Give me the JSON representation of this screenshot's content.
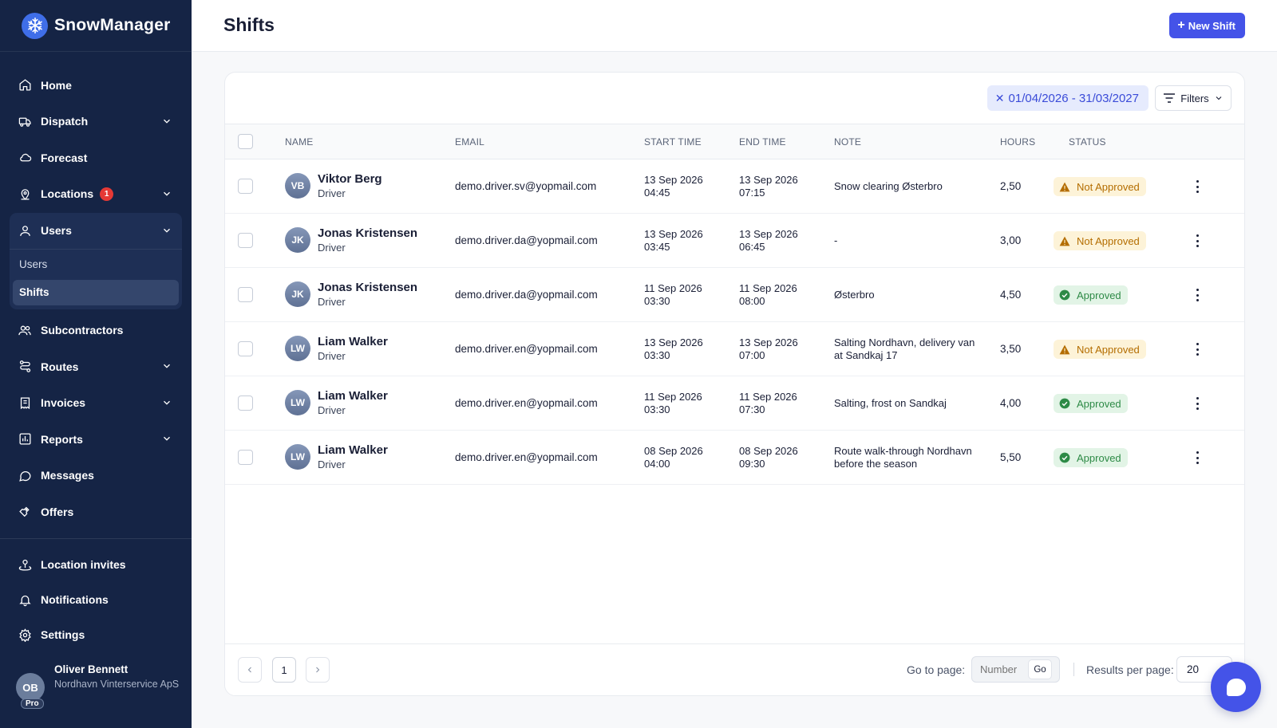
{
  "brand": {
    "name": "SnowManager"
  },
  "sidebar": {
    "items": [
      {
        "label": "Home",
        "icon": "home-icon"
      },
      {
        "label": "Dispatch",
        "icon": "truck-icon",
        "expandable": true
      },
      {
        "label": "Forecast",
        "icon": "cloud-icon"
      },
      {
        "label": "Locations",
        "icon": "pin-icon",
        "expandable": true,
        "badge": "1"
      },
      {
        "label": "Users",
        "icon": "user-icon",
        "expandable": true,
        "expanded": true,
        "children": [
          "Users",
          "Shifts"
        ],
        "active_child": "Shifts"
      },
      {
        "label": "Subcontractors",
        "icon": "users-icon"
      },
      {
        "label": "Routes",
        "icon": "route-icon",
        "expandable": true
      },
      {
        "label": "Invoices",
        "icon": "invoice-icon",
        "expandable": true
      },
      {
        "label": "Reports",
        "icon": "chart-icon",
        "expandable": true
      },
      {
        "label": "Messages",
        "icon": "message-icon"
      },
      {
        "label": "Offers",
        "icon": "offer-icon"
      }
    ],
    "bottom_items": [
      {
        "label": "Location invites",
        "icon": "location-invite-icon"
      },
      {
        "label": "Notifications",
        "icon": "bell-icon"
      },
      {
        "label": "Settings",
        "icon": "gear-icon"
      }
    ],
    "profile": {
      "initials": "OB",
      "plan": "Pro",
      "name": "Oliver Bennett",
      "org": "Nordhavn Vinterservice ApS"
    }
  },
  "header": {
    "title": "Shifts",
    "new_button": "New Shift"
  },
  "toolbar": {
    "date_range": "01/04/2026 - 31/03/2027",
    "filters_label": "Filters"
  },
  "table": {
    "columns": [
      "NAME",
      "EMAIL",
      "START TIME",
      "END TIME",
      "NOTE",
      "HOURS",
      "STATUS"
    ],
    "rows": [
      {
        "initials": "VB",
        "name": "Viktor Berg",
        "role": "Driver",
        "email": "demo.driver.sv@yopmail.com",
        "start_date": "13 Sep 2026",
        "start_time": "04:45",
        "end_date": "13 Sep 2026",
        "end_time": "07:15",
        "note": "Snow clearing Østerbro",
        "hours": "2,50",
        "status": "Not Approved",
        "status_kind": "warning"
      },
      {
        "initials": "JK",
        "name": "Jonas Kristensen",
        "role": "Driver",
        "email": "demo.driver.da@yopmail.com",
        "start_date": "13 Sep 2026",
        "start_time": "03:45",
        "end_date": "13 Sep 2026",
        "end_time": "06:45",
        "note": "-",
        "hours": "3,00",
        "status": "Not Approved",
        "status_kind": "warning"
      },
      {
        "initials": "JK",
        "name": "Jonas Kristensen",
        "role": "Driver",
        "email": "demo.driver.da@yopmail.com",
        "start_date": "11 Sep 2026",
        "start_time": "03:30",
        "end_date": "11 Sep 2026",
        "end_time": "08:00",
        "note": "Østerbro",
        "hours": "4,50",
        "status": "Approved",
        "status_kind": "success"
      },
      {
        "initials": "LW",
        "name": "Liam Walker",
        "role": "Driver",
        "email": "demo.driver.en@yopmail.com",
        "start_date": "13 Sep 2026",
        "start_time": "03:30",
        "end_date": "13 Sep 2026",
        "end_time": "07:00",
        "note": "Salting Nordhavn, delivery van at Sandkaj 17",
        "hours": "3,50",
        "status": "Not Approved",
        "status_kind": "warning"
      },
      {
        "initials": "LW",
        "name": "Liam Walker",
        "role": "Driver",
        "email": "demo.driver.en@yopmail.com",
        "start_date": "11 Sep 2026",
        "start_time": "03:30",
        "end_date": "11 Sep 2026",
        "end_time": "07:30",
        "note": "Salting, frost on Sandkaj",
        "hours": "4,00",
        "status": "Approved",
        "status_kind": "success"
      },
      {
        "initials": "LW",
        "name": "Liam Walker",
        "role": "Driver",
        "email": "demo.driver.en@yopmail.com",
        "start_date": "08 Sep 2026",
        "start_time": "04:00",
        "end_date": "08 Sep 2026",
        "end_time": "09:30",
        "note": "Route walk-through Nordhavn before the season",
        "hours": "5,50",
        "status": "Approved",
        "status_kind": "success"
      }
    ]
  },
  "pagination": {
    "current_page": "1",
    "goto_label": "Go to page:",
    "goto_placeholder": "Number",
    "go_button": "Go",
    "rpp_label": "Results per page:",
    "rpp_value": "20"
  },
  "colors": {
    "sidebar_bg": "#152445",
    "accent": "#4453e8",
    "warning_bg": "#fdf3d8",
    "warning_text": "#b46d00",
    "success_bg": "#e2f4e6",
    "success_text": "#2d8a46"
  }
}
